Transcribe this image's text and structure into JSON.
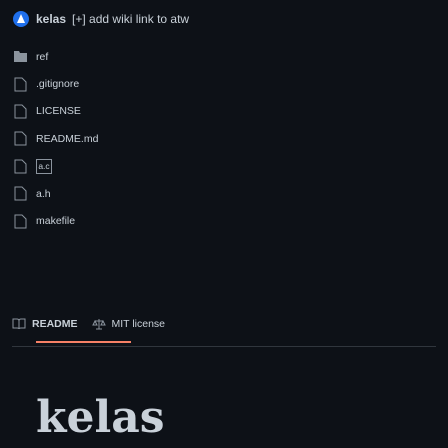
{
  "header": {
    "repo_name": "kelas",
    "actions": "[+] add wiki link to atw"
  },
  "files": [
    {
      "name": "ref",
      "type": "folder"
    },
    {
      "name": ".gitignore",
      "type": "file"
    },
    {
      "name": "LICENSE",
      "type": "file"
    },
    {
      "name": "README.md",
      "type": "file"
    },
    {
      "name": "a.c",
      "type": "file"
    },
    {
      "name": "a.h",
      "type": "file"
    },
    {
      "name": "makefile",
      "type": "file"
    }
  ],
  "tabs": {
    "readme_label": "README",
    "license_label": "MIT license"
  },
  "readme": {
    "title": "kelas"
  },
  "colors": {
    "background": "#0d1117",
    "text": "#c9d1d9",
    "muted": "#8b949e",
    "accent": "#f78166",
    "divider": "#30363d"
  }
}
